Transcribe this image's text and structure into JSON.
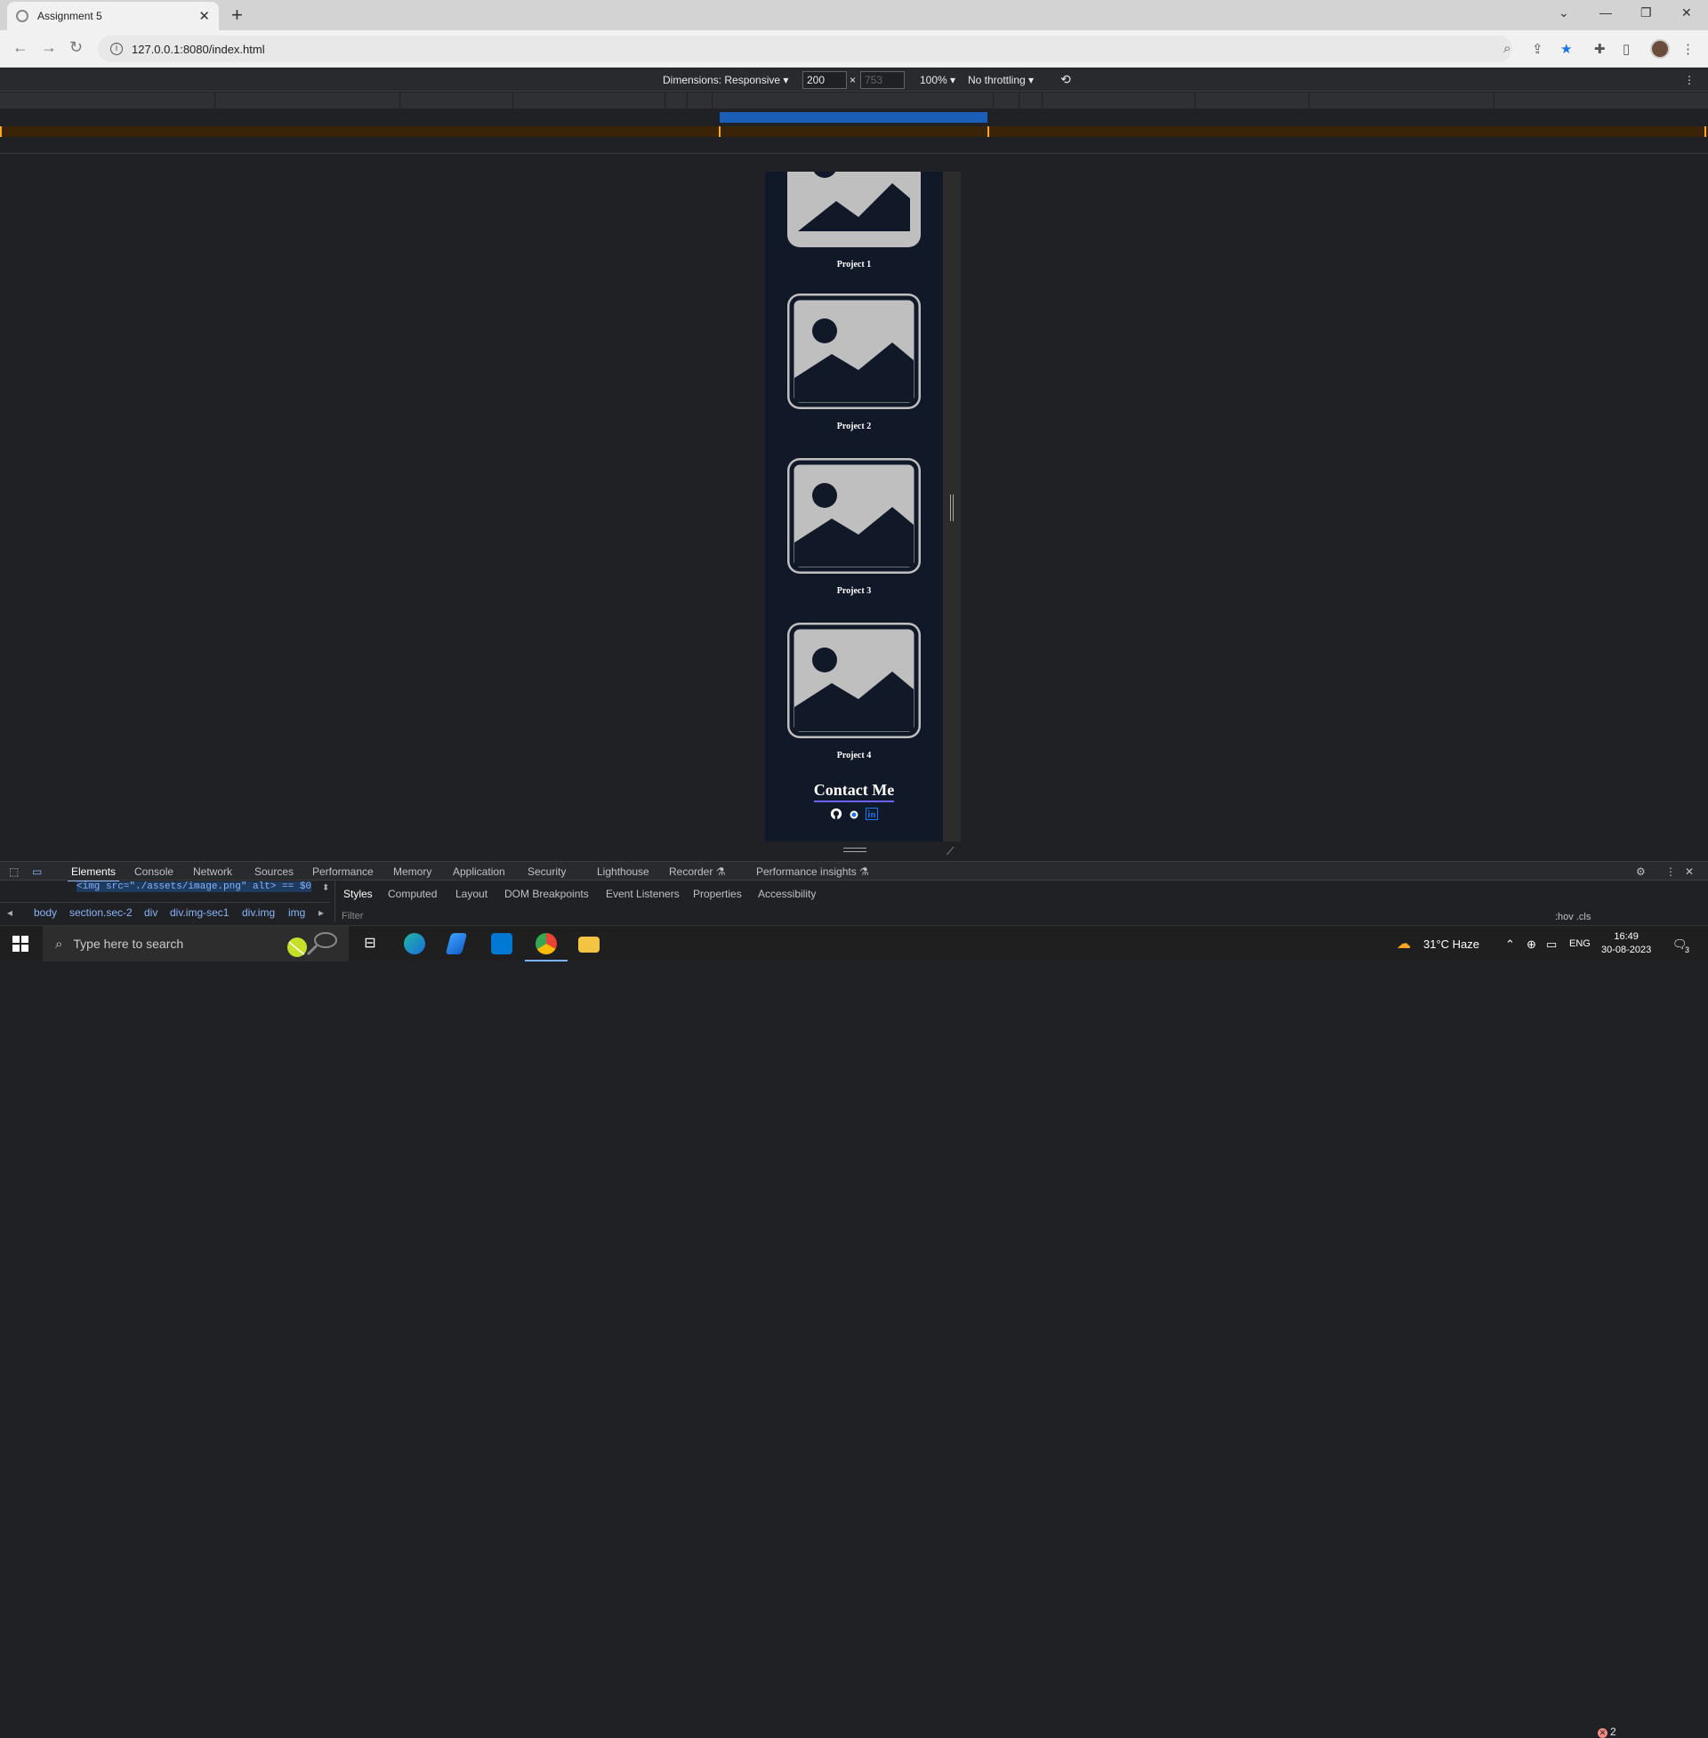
{
  "browser": {
    "tab_title": "Assignment 5",
    "url": "127.0.0.1:8080/index.html"
  },
  "device_toolbar": {
    "dimensions_label": "Dimensions: Responsive",
    "width": "200",
    "height": "753",
    "zoom": "100%",
    "throttling": "No throttling"
  },
  "page": {
    "projects": [
      {
        "label": "Project 1"
      },
      {
        "label": "Project 2"
      },
      {
        "label": "Project 3"
      },
      {
        "label": "Project 4"
      }
    ],
    "contact_heading": "Contact Me",
    "social_icons": [
      "github-icon",
      "dot-icon",
      "linkedin-icon"
    ],
    "colors": {
      "background": "#111827",
      "accent": "#6c63ff",
      "placeholder": "#bfbfbf"
    }
  },
  "devtools": {
    "tabs": [
      "Elements",
      "Console",
      "Network",
      "Sources",
      "Performance",
      "Memory",
      "Application",
      "Security",
      "Lighthouse",
      "Recorder ⚗",
      "Performance insights ⚗"
    ],
    "active_tab": "Elements",
    "error_count": "2",
    "selected_node": "<img src=\"./assets/image.png\" alt> == $0",
    "breadcrumbs": [
      "body",
      "section.sec-2",
      "div",
      "div.img-sec1",
      "div.img",
      "img"
    ],
    "side_tabs": [
      "Styles",
      "Computed",
      "Layout",
      "DOM Breakpoints",
      "Event Listeners",
      "Properties",
      "Accessibility"
    ],
    "filter_placeholder": "Filter",
    "hov_cls": ":hov  .cls"
  },
  "taskbar": {
    "search_placeholder": "Type here to search",
    "weather": "31°C  Haze",
    "language": "ENG",
    "time": "16:49",
    "date": "30-08-2023",
    "notification_count": "3"
  }
}
